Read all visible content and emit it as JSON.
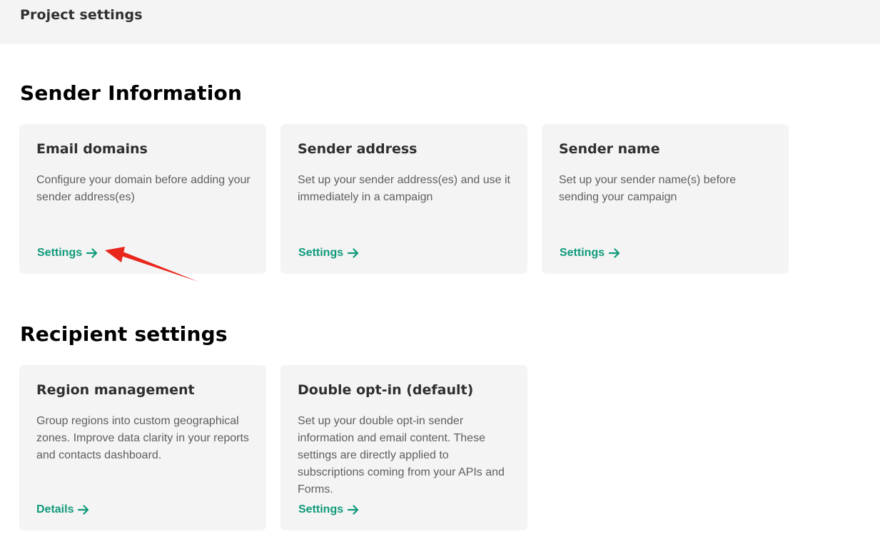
{
  "header": {
    "title": "Project settings"
  },
  "sections": {
    "sender": {
      "title": "Sender Information",
      "cards": [
        {
          "title": "Email domains",
          "description": "Configure your domain before adding your sender address(es)",
          "link": "Settings"
        },
        {
          "title": "Sender address",
          "description": "Set up your sender address(es) and use it immediately in a campaign",
          "link": "Settings"
        },
        {
          "title": "Sender name",
          "description": "Set up your sender name(s) before sending your campaign",
          "link": "Settings"
        }
      ]
    },
    "recipient": {
      "title": "Recipient settings",
      "cards": [
        {
          "title": "Region management",
          "description": "Group regions into custom geographical zones. Improve data clarity in your reports and contacts dashboard.",
          "link": "Details"
        },
        {
          "title": "Double opt-in (default)",
          "description": "Set up your double opt-in sender information and email content. These settings are directly applied to subscriptions coming from your APIs and Forms.",
          "link": "Settings"
        }
      ]
    }
  },
  "colors": {
    "link": "#0f9a7a",
    "card_bg": "#f4f4f5",
    "annotation_arrow": "#e8261c"
  },
  "icons": {
    "link_arrow": "arrow-right-icon"
  }
}
